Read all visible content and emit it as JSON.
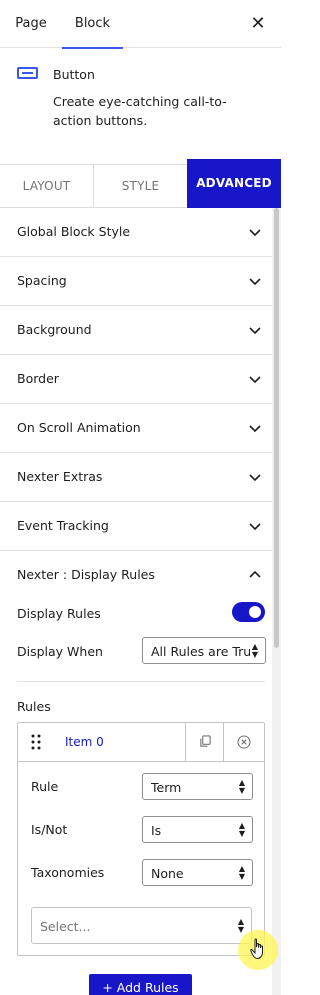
{
  "header": {
    "tabs": [
      "Page",
      "Block"
    ],
    "active_tab": "Block",
    "close_icon": "close-icon"
  },
  "block": {
    "icon": "button-block-icon",
    "title": "Button",
    "description": "Create eye-catching call-to-action buttons."
  },
  "settings_tabs": {
    "items": [
      "LAYOUT",
      "STYLE",
      "ADVANCED"
    ],
    "active": "ADVANCED"
  },
  "panels": [
    {
      "label": "Global Block Style",
      "expanded": false
    },
    {
      "label": "Spacing",
      "expanded": false
    },
    {
      "label": "Background",
      "expanded": false
    },
    {
      "label": "Border",
      "expanded": false
    },
    {
      "label": "On Scroll Animation",
      "expanded": false
    },
    {
      "label": "Nexter Extras",
      "expanded": false
    },
    {
      "label": "Event Tracking",
      "expanded": false
    },
    {
      "label": "Nexter : Display Rules",
      "expanded": true
    }
  ],
  "display_rules": {
    "toggle_label": "Display Rules",
    "toggle_on": true,
    "when_label": "Display When",
    "when_value": "All Rules are True",
    "rules_label": "Rules",
    "item": {
      "title": "Item 0",
      "copy_icon": "copy-icon",
      "remove_icon": "remove-circle-icon",
      "drag_icon": "drag-handle-icon",
      "fields": [
        {
          "label": "Rule",
          "value": "Term"
        },
        {
          "label": "Is/Not",
          "value": "Is"
        },
        {
          "label": "Taxonomies",
          "value": "None"
        }
      ],
      "select_placeholder": "Select..."
    },
    "add_button": "+ Add Rules"
  },
  "colors": {
    "accent": "#1717c9",
    "tab_underline": "#3858e9",
    "border": "#e0e0e0"
  }
}
